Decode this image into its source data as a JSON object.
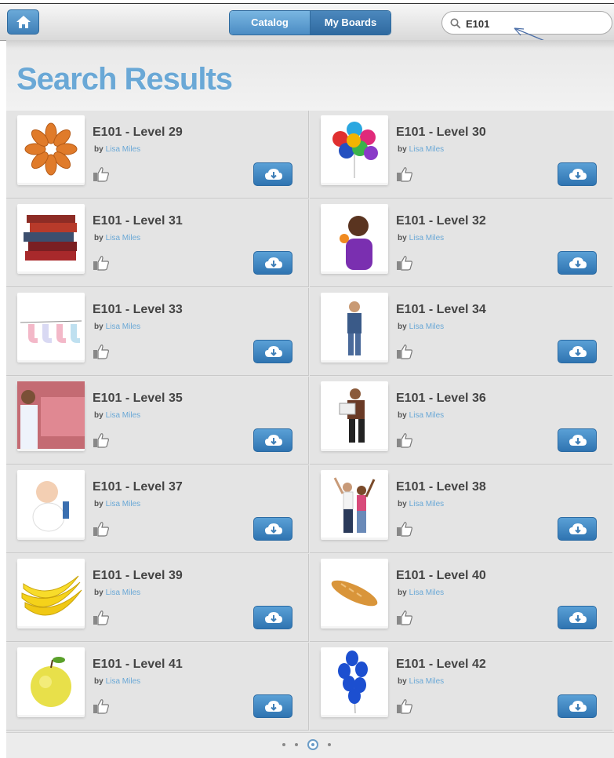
{
  "toolbar": {
    "home_icon": "home-icon",
    "tabs": [
      {
        "label": "Catalog"
      },
      {
        "label": "My Boards"
      }
    ],
    "search_value": "E101"
  },
  "page_title": "Search Results",
  "results": [
    {
      "title": "E101 - Level 29",
      "by": "by",
      "author": "Lisa Miles",
      "image": "almonds"
    },
    {
      "title": "E101 - Level 30",
      "by": "by",
      "author": "Lisa Miles",
      "image": "balloons"
    },
    {
      "title": "E101 - Level 31",
      "by": "by",
      "author": "Lisa Miles",
      "image": "books"
    },
    {
      "title": "E101 - Level 32",
      "by": "by",
      "author": "Lisa Miles",
      "image": "girl-with-fruit"
    },
    {
      "title": "E101 - Level 33",
      "by": "by",
      "author": "Lisa Miles",
      "image": "baby-socks"
    },
    {
      "title": "E101 - Level 34",
      "by": "by",
      "author": "Lisa Miles",
      "image": "boy-standing"
    },
    {
      "title": "E101 - Level 35",
      "by": "by",
      "author": "Lisa Miles",
      "image": "meat-counter"
    },
    {
      "title": "E101 - Level 36",
      "by": "by",
      "author": "Lisa Miles",
      "image": "man-reading"
    },
    {
      "title": "E101 - Level 37",
      "by": "by",
      "author": "Lisa Miles",
      "image": "baby"
    },
    {
      "title": "E101 - Level 38",
      "by": "by",
      "author": "Lisa Miles",
      "image": "couple-cheering"
    },
    {
      "title": "E101 - Level 39",
      "by": "by",
      "author": "Lisa Miles",
      "image": "bananas"
    },
    {
      "title": "E101 - Level 40",
      "by": "by",
      "author": "Lisa Miles",
      "image": "bread"
    },
    {
      "title": "E101 - Level 41",
      "by": "by",
      "author": "Lisa Miles",
      "image": "apple"
    },
    {
      "title": "E101 - Level 42",
      "by": "by",
      "author": "Lisa Miles",
      "image": "blue-balloons"
    }
  ],
  "pagination": {
    "pages": 4,
    "current": 3
  },
  "colors": {
    "accent": "#6aa8d6",
    "button": "#3f7fb7"
  }
}
